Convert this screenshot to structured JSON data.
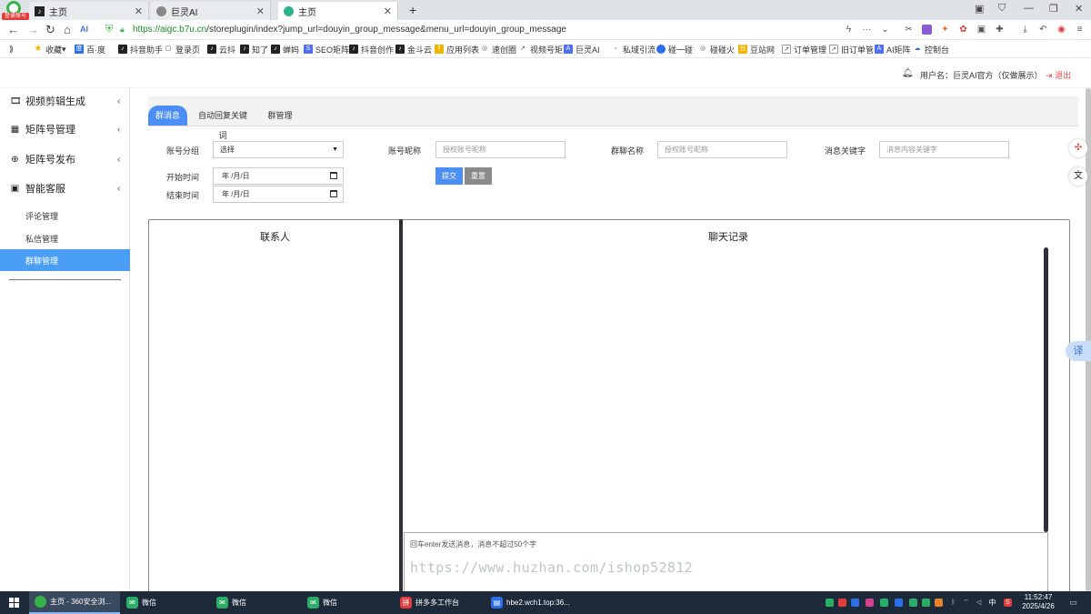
{
  "browser": {
    "badge_text": "登录账号",
    "tabs": [
      {
        "label": "主页",
        "active": false
      },
      {
        "label": "巨灵AI",
        "active": false
      },
      {
        "label": "主页",
        "active": true
      }
    ],
    "new_tab": "+",
    "url_host": "https://aigc.b7u.cn",
    "url_path": "/storeplugin/index?jump_url=douyin_group_message&menu_url=douyin_group_message",
    "bookmarks": [
      "收藏",
      "百·度",
      "抖音助手",
      "登录页",
      "云抖",
      "知了",
      "蝉妈",
      "SEO矩阵",
      "抖音创作",
      "金斗云",
      "应用列表",
      "速创圈",
      "视频号矩",
      "巨灵AI",
      "私域引流",
      "碰一碰",
      "碰碰火",
      "豆站网",
      "订单管理",
      "旧订单管",
      "AI矩阵",
      "控制台"
    ]
  },
  "header": {
    "username": "用户名：巨灵AI官方（仅做展示）",
    "logout": "退出"
  },
  "sidebar": {
    "menus": [
      {
        "label": "视频剪辑生成",
        "icon": "film-icon"
      },
      {
        "label": "矩阵号管理",
        "icon": "grid-icon"
      },
      {
        "label": "矩阵号发布",
        "icon": "plus-circle-icon"
      },
      {
        "label": "智能客服",
        "icon": "robot-icon"
      }
    ],
    "sub_items": [
      "评论管理",
      "私信管理",
      "群聊管理"
    ],
    "active_sub": "群聊管理"
  },
  "content": {
    "tabs": [
      "群消息",
      "自动回复关键词",
      "群管理"
    ],
    "active_tab": "群消息",
    "filters": {
      "account_group_label": "账号分组",
      "account_group_value": "选择",
      "account_nick_label": "账号昵称",
      "account_nick_placeholder": "授权账号昵称",
      "group_name_label": "群聊名称",
      "group_name_placeholder": "授权账号昵称",
      "keyword_label": "消息关键字",
      "keyword_placeholder": "消息内容关键字",
      "start_label": "开始时间",
      "start_value": "年 /月/日",
      "end_label": "结束时间",
      "end_value": "年 /月/日",
      "submit_label": "提交",
      "reset_label": "重置"
    },
    "panel": {
      "contacts_title": "联系人",
      "chat_title": "聊天记录",
      "input_hint": "回车enter发送消息，消息不超过50个字",
      "watermark": "https://www.huzhan.com/ishop52812"
    },
    "float": {
      "translate": "译"
    }
  },
  "taskbar": {
    "items": [
      {
        "label": "主页 - 360安全浏...",
        "active": true
      },
      {
        "label": "微信",
        "active": false
      },
      {
        "label": "微信",
        "active": false
      },
      {
        "label": "微信",
        "active": false
      },
      {
        "label": "拼多多工作台",
        "active": false
      },
      {
        "label": "hbe2.wch1.top:36...",
        "active": false
      }
    ],
    "ime": "中",
    "time": "11:52:47",
    "date": "2025/4/26"
  },
  "colors": {
    "accent": "#4b8ef5",
    "active_menu": "#4b9ef5",
    "logout": "#e04848",
    "submit": "#4b8ef5",
    "reset": "#8a8a8a",
    "taskbar": "#1d2a3a"
  }
}
